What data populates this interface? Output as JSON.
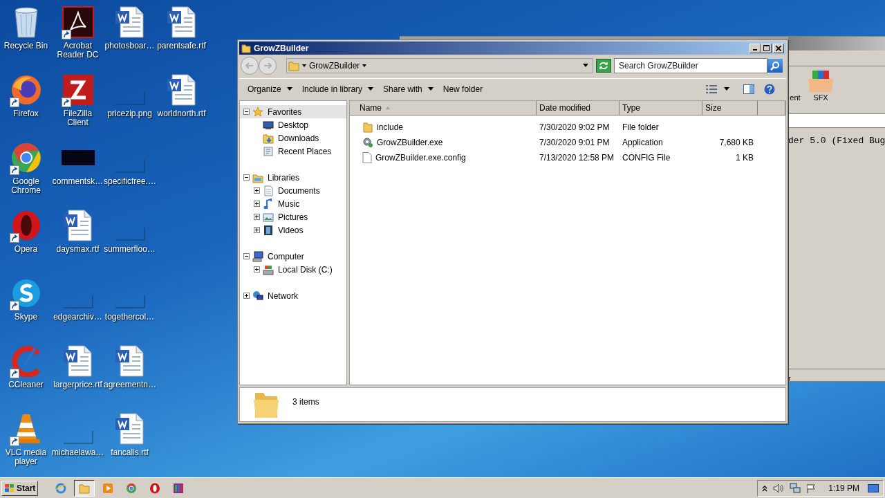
{
  "desktop_icons": [
    {
      "label": "Recycle Bin",
      "kind": "recycle-bin",
      "shortcut": false
    },
    {
      "label": "Firefox",
      "kind": "firefox",
      "shortcut": true
    },
    {
      "label": "Google Chrome",
      "kind": "chrome",
      "shortcut": true
    },
    {
      "label": "Opera",
      "kind": "opera",
      "shortcut": true
    },
    {
      "label": "Skype",
      "kind": "skype",
      "shortcut": true
    },
    {
      "label": "CCleaner",
      "kind": "ccleaner",
      "shortcut": true
    },
    {
      "label": "VLC media player",
      "kind": "vlc",
      "shortcut": true
    },
    {
      "label": "Acrobat Reader DC",
      "kind": "acrobat",
      "shortcut": true
    },
    {
      "label": "FileZilla Client",
      "kind": "filezilla",
      "shortcut": true
    },
    {
      "label": "commentsk…",
      "kind": "dark-thumb",
      "shortcut": false
    },
    {
      "label": "daysmax.rtf",
      "kind": "doc",
      "shortcut": false
    },
    {
      "label": "edgearchiv…",
      "kind": "blank",
      "shortcut": false
    },
    {
      "label": "largerprice.rtf",
      "kind": "doc",
      "shortcut": false
    },
    {
      "label": "michaelawa…",
      "kind": "blank",
      "shortcut": false
    },
    {
      "label": "photosboar…",
      "kind": "doc",
      "shortcut": false
    },
    {
      "label": "pricezip.png",
      "kind": "blank",
      "shortcut": false
    },
    {
      "label": "specificfree.…",
      "kind": "blank",
      "shortcut": false
    },
    {
      "label": "summerfloo…",
      "kind": "blank",
      "shortcut": false
    },
    {
      "label": "togethercol…",
      "kind": "blank",
      "shortcut": false
    },
    {
      "label": "agreementn…",
      "kind": "doc",
      "shortcut": false
    },
    {
      "label": "fancalls.rtf",
      "kind": "doc",
      "shortcut": false
    },
    {
      "label": "parentsafe.rtf",
      "kind": "doc",
      "shortcut": false
    },
    {
      "label": "worldnorth.rtf",
      "kind": "doc",
      "shortcut": false
    }
  ],
  "background_window": {
    "toolbar_items": [
      {
        "label": "ent",
        "kind": "cut"
      },
      {
        "label": "SFX",
        "kind": "archive"
      }
    ],
    "log_line": "der 5.0 (Fixed Bug",
    "status_text": "r"
  },
  "explorer": {
    "title": "GrowZBuilder",
    "address": "GrowZBuilder",
    "search": {
      "placeholder": "Search GrowZBuilder"
    },
    "commands": [
      {
        "label": "Organize",
        "dropdown": true
      },
      {
        "label": "Include in library",
        "dropdown": true
      },
      {
        "label": "Share with",
        "dropdown": true
      },
      {
        "label": "New folder",
        "dropdown": false
      }
    ],
    "nav_tree": [
      {
        "label": "Favorites",
        "kind": "star",
        "expanded": true,
        "selected": true,
        "children": [
          {
            "label": "Desktop",
            "kind": "desktop",
            "selected": false
          },
          {
            "label": "Downloads",
            "kind": "downloads",
            "selected": false
          },
          {
            "label": "Recent Places",
            "kind": "recent",
            "selected": false
          }
        ]
      },
      {
        "label": "Libraries",
        "kind": "library",
        "expanded": true,
        "selected": false,
        "children": [
          {
            "label": "Documents",
            "kind": "documents",
            "expanded": false,
            "selected": false
          },
          {
            "label": "Music",
            "kind": "music",
            "expanded": false,
            "selected": false
          },
          {
            "label": "Pictures",
            "kind": "pictures",
            "expanded": false,
            "selected": false
          },
          {
            "label": "Videos",
            "kind": "videos",
            "expanded": false,
            "selected": false
          }
        ]
      },
      {
        "label": "Computer",
        "kind": "computer",
        "expanded": true,
        "selected": false,
        "children": [
          {
            "label": "Local Disk (C:)",
            "kind": "disk",
            "expanded": false,
            "selected": false
          }
        ]
      },
      {
        "label": "Network",
        "kind": "network",
        "expanded": false,
        "selected": false
      }
    ],
    "columns": [
      {
        "label": "Name",
        "sorted": true
      },
      {
        "label": "Date modified",
        "sorted": false
      },
      {
        "label": "Type",
        "sorted": false
      },
      {
        "label": "Size",
        "sorted": false
      }
    ],
    "files": [
      {
        "kind": "folder",
        "name": "include",
        "date": "7/30/2020 9:02 PM",
        "type": "File folder"
      },
      {
        "kind": "exe",
        "name": "GrowZBuilder.exe",
        "date": "7/30/2020 9:01 PM",
        "type": "Application",
        "size": "7,680 KB"
      },
      {
        "kind": "file",
        "name": "GrowZBuilder.exe.config",
        "date": "7/13/2020 12:58 PM",
        "type": "CONFIG File",
        "size": "1 KB"
      }
    ],
    "item_count": "3 items"
  },
  "taskbar": {
    "start_label": "Start",
    "pinned": [
      {
        "kind": "ie",
        "selected": false
      },
      {
        "kind": "explorer",
        "selected": true
      },
      {
        "kind": "media",
        "selected": false
      },
      {
        "kind": "chrome",
        "selected": false
      },
      {
        "kind": "opera",
        "selected": false
      },
      {
        "kind": "archive",
        "selected": false
      }
    ],
    "clock": "1:19 PM"
  }
}
